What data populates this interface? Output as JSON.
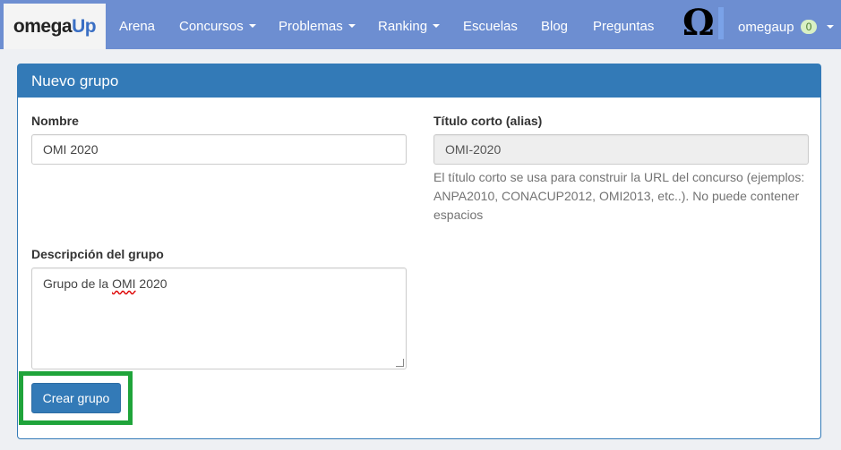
{
  "navbar": {
    "brand_omega": "omega",
    "brand_up": "Up",
    "items": [
      {
        "label": "Arena",
        "dropdown": false
      },
      {
        "label": "Concursos",
        "dropdown": true
      },
      {
        "label": "Problemas",
        "dropdown": true
      },
      {
        "label": "Ranking",
        "dropdown": true
      },
      {
        "label": "Escuelas",
        "dropdown": false
      },
      {
        "label": "Blog",
        "dropdown": false
      },
      {
        "label": "Preguntas",
        "dropdown": false
      }
    ],
    "logo_glyph": "Ω",
    "username": "omegaup",
    "notification_count": "0"
  },
  "panel": {
    "title": "Nuevo grupo",
    "name_label": "Nombre",
    "name_value": "OMI 2020",
    "alias_label": "Título corto (alias)",
    "alias_value": "OMI-2020",
    "alias_help": "El título corto se usa para construir la URL del concurso (ejemplos: ANPA2010, CONACUP2012, OMI2013, etc..). No puede contener espacios",
    "description_label": "Descripción del grupo",
    "description_prefix": "Grupo de la ",
    "description_misspelled": "OMI",
    "description_suffix": " 2020",
    "submit_label": "Crear grupo"
  },
  "colors": {
    "navbar": "#6d8ed1",
    "primary": "#337ab7",
    "highlight": "#1fa43a"
  }
}
